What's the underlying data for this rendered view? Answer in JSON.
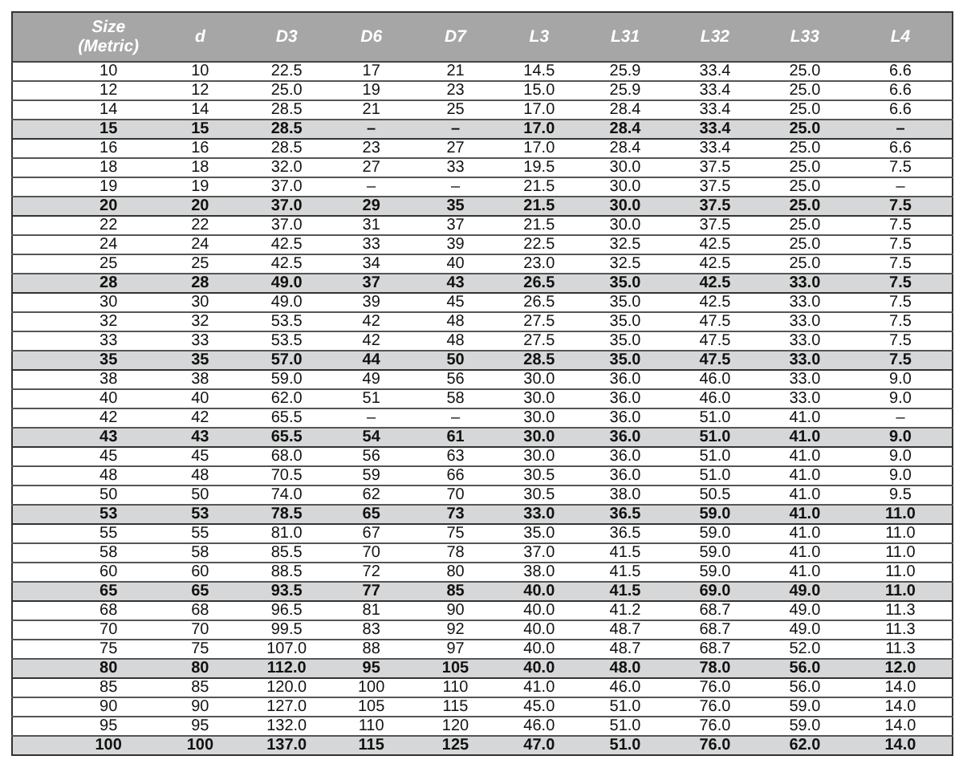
{
  "table": {
    "columns": [
      {
        "label": "Size",
        "sublabel": "(Metric)"
      },
      {
        "label": "d"
      },
      {
        "label": "D3"
      },
      {
        "label": "D6"
      },
      {
        "label": "D7"
      },
      {
        "label": "L3"
      },
      {
        "label": "L31"
      },
      {
        "label": "L32"
      },
      {
        "label": "L33"
      },
      {
        "label": "L4"
      }
    ],
    "rows": [
      {
        "highlighted": false,
        "cells": [
          "10",
          "10",
          "22.5",
          "17",
          "21",
          "14.5",
          "25.9",
          "33.4",
          "25.0",
          "6.6"
        ]
      },
      {
        "highlighted": false,
        "cells": [
          "12",
          "12",
          "25.0",
          "19",
          "23",
          "15.0",
          "25.9",
          "33.4",
          "25.0",
          "6.6"
        ]
      },
      {
        "highlighted": false,
        "cells": [
          "14",
          "14",
          "28.5",
          "21",
          "25",
          "17.0",
          "28.4",
          "33.4",
          "25.0",
          "6.6"
        ]
      },
      {
        "highlighted": true,
        "cells": [
          "15",
          "15",
          "28.5",
          "–",
          "–",
          "17.0",
          "28.4",
          "33.4",
          "25.0",
          "–"
        ]
      },
      {
        "highlighted": false,
        "cells": [
          "16",
          "16",
          "28.5",
          "23",
          "27",
          "17.0",
          "28.4",
          "33.4",
          "25.0",
          "6.6"
        ]
      },
      {
        "highlighted": false,
        "cells": [
          "18",
          "18",
          "32.0",
          "27",
          "33",
          "19.5",
          "30.0",
          "37.5",
          "25.0",
          "7.5"
        ]
      },
      {
        "highlighted": false,
        "cells": [
          "19",
          "19",
          "37.0",
          "–",
          "–",
          "21.5",
          "30.0",
          "37.5",
          "25.0",
          "–"
        ]
      },
      {
        "highlighted": true,
        "cells": [
          "20",
          "20",
          "37.0",
          "29",
          "35",
          "21.5",
          "30.0",
          "37.5",
          "25.0",
          "7.5"
        ]
      },
      {
        "highlighted": false,
        "cells": [
          "22",
          "22",
          "37.0",
          "31",
          "37",
          "21.5",
          "30.0",
          "37.5",
          "25.0",
          "7.5"
        ]
      },
      {
        "highlighted": false,
        "cells": [
          "24",
          "24",
          "42.5",
          "33",
          "39",
          "22.5",
          "32.5",
          "42.5",
          "25.0",
          "7.5"
        ]
      },
      {
        "highlighted": false,
        "cells": [
          "25",
          "25",
          "42.5",
          "34",
          "40",
          "23.0",
          "32.5",
          "42.5",
          "25.0",
          "7.5"
        ]
      },
      {
        "highlighted": true,
        "cells": [
          "28",
          "28",
          "49.0",
          "37",
          "43",
          "26.5",
          "35.0",
          "42.5",
          "33.0",
          "7.5"
        ]
      },
      {
        "highlighted": false,
        "cells": [
          "30",
          "30",
          "49.0",
          "39",
          "45",
          "26.5",
          "35.0",
          "42.5",
          "33.0",
          "7.5"
        ]
      },
      {
        "highlighted": false,
        "cells": [
          "32",
          "32",
          "53.5",
          "42",
          "48",
          "27.5",
          "35.0",
          "47.5",
          "33.0",
          "7.5"
        ]
      },
      {
        "highlighted": false,
        "cells": [
          "33",
          "33",
          "53.5",
          "42",
          "48",
          "27.5",
          "35.0",
          "47.5",
          "33.0",
          "7.5"
        ]
      },
      {
        "highlighted": true,
        "cells": [
          "35",
          "35",
          "57.0",
          "44",
          "50",
          "28.5",
          "35.0",
          "47.5",
          "33.0",
          "7.5"
        ]
      },
      {
        "highlighted": false,
        "cells": [
          "38",
          "38",
          "59.0",
          "49",
          "56",
          "30.0",
          "36.0",
          "46.0",
          "33.0",
          "9.0"
        ]
      },
      {
        "highlighted": false,
        "cells": [
          "40",
          "40",
          "62.0",
          "51",
          "58",
          "30.0",
          "36.0",
          "46.0",
          "33.0",
          "9.0"
        ]
      },
      {
        "highlighted": false,
        "cells": [
          "42",
          "42",
          "65.5",
          "–",
          "–",
          "30.0",
          "36.0",
          "51.0",
          "41.0",
          "–"
        ]
      },
      {
        "highlighted": true,
        "cells": [
          "43",
          "43",
          "65.5",
          "54",
          "61",
          "30.0",
          "36.0",
          "51.0",
          "41.0",
          "9.0"
        ]
      },
      {
        "highlighted": false,
        "cells": [
          "45",
          "45",
          "68.0",
          "56",
          "63",
          "30.0",
          "36.0",
          "51.0",
          "41.0",
          "9.0"
        ]
      },
      {
        "highlighted": false,
        "cells": [
          "48",
          "48",
          "70.5",
          "59",
          "66",
          "30.5",
          "36.0",
          "51.0",
          "41.0",
          "9.0"
        ]
      },
      {
        "highlighted": false,
        "cells": [
          "50",
          "50",
          "74.0",
          "62",
          "70",
          "30.5",
          "38.0",
          "50.5",
          "41.0",
          "9.5"
        ]
      },
      {
        "highlighted": true,
        "cells": [
          "53",
          "53",
          "78.5",
          "65",
          "73",
          "33.0",
          "36.5",
          "59.0",
          "41.0",
          "11.0"
        ]
      },
      {
        "highlighted": false,
        "cells": [
          "55",
          "55",
          "81.0",
          "67",
          "75",
          "35.0",
          "36.5",
          "59.0",
          "41.0",
          "11.0"
        ]
      },
      {
        "highlighted": false,
        "cells": [
          "58",
          "58",
          "85.5",
          "70",
          "78",
          "37.0",
          "41.5",
          "59.0",
          "41.0",
          "11.0"
        ]
      },
      {
        "highlighted": false,
        "cells": [
          "60",
          "60",
          "88.5",
          "72",
          "80",
          "38.0",
          "41.5",
          "59.0",
          "41.0",
          "11.0"
        ]
      },
      {
        "highlighted": true,
        "cells": [
          "65",
          "65",
          "93.5",
          "77",
          "85",
          "40.0",
          "41.5",
          "69.0",
          "49.0",
          "11.0"
        ]
      },
      {
        "highlighted": false,
        "cells": [
          "68",
          "68",
          "96.5",
          "81",
          "90",
          "40.0",
          "41.2",
          "68.7",
          "49.0",
          "11.3"
        ]
      },
      {
        "highlighted": false,
        "cells": [
          "70",
          "70",
          "99.5",
          "83",
          "92",
          "40.0",
          "48.7",
          "68.7",
          "49.0",
          "11.3"
        ]
      },
      {
        "highlighted": false,
        "cells": [
          "75",
          "75",
          "107.0",
          "88",
          "97",
          "40.0",
          "48.7",
          "68.7",
          "52.0",
          "11.3"
        ]
      },
      {
        "highlighted": true,
        "cells": [
          "80",
          "80",
          "112.0",
          "95",
          "105",
          "40.0",
          "48.0",
          "78.0",
          "56.0",
          "12.0"
        ]
      },
      {
        "highlighted": false,
        "cells": [
          "85",
          "85",
          "120.0",
          "100",
          "110",
          "41.0",
          "46.0",
          "76.0",
          "56.0",
          "14.0"
        ]
      },
      {
        "highlighted": false,
        "cells": [
          "90",
          "90",
          "127.0",
          "105",
          "115",
          "45.0",
          "51.0",
          "76.0",
          "59.0",
          "14.0"
        ]
      },
      {
        "highlighted": false,
        "cells": [
          "95",
          "95",
          "132.0",
          "110",
          "120",
          "46.0",
          "51.0",
          "76.0",
          "59.0",
          "14.0"
        ]
      },
      {
        "highlighted": true,
        "cells": [
          "100",
          "100",
          "137.0",
          "115",
          "125",
          "47.0",
          "51.0",
          "76.0",
          "62.0",
          "14.0"
        ]
      }
    ]
  }
}
